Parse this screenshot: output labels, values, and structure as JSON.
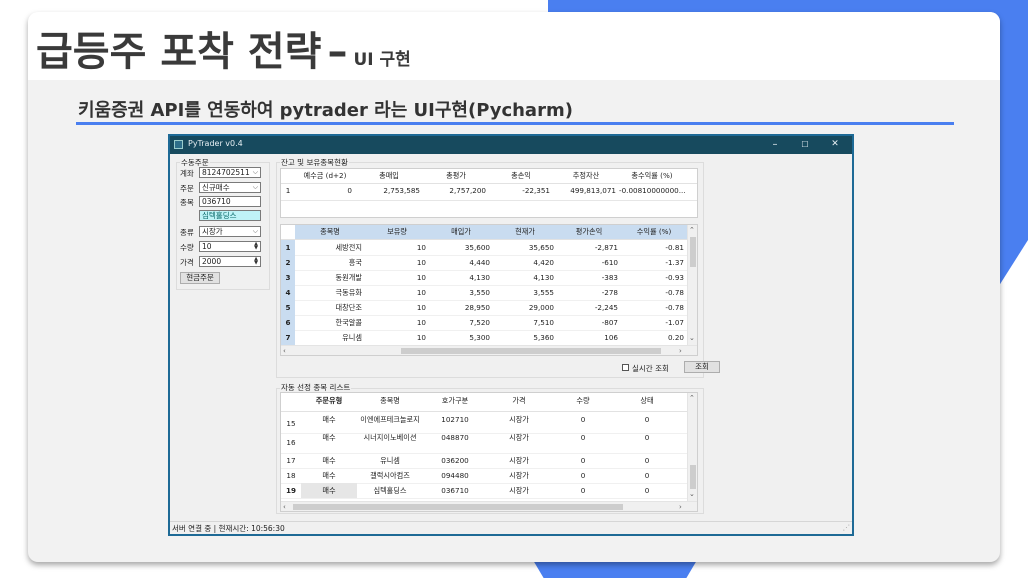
{
  "slide": {
    "title": "급등주 포착 전략",
    "title_dash": "–",
    "title_sub": "UI 구현",
    "subtitle": "키움증권 API를 연동하여 pytrader 라는 UI구현(Pycharm)",
    "accent_color": "#4a7ff0"
  },
  "window": {
    "title": "PyTrader v0.4",
    "buttons": {
      "minimize": "–",
      "maximize": "☐",
      "close": "✕"
    }
  },
  "order_panel": {
    "group_label": "수동주문",
    "account_label": "계좌",
    "account_value": "8124702511",
    "order_label": "주문",
    "order_value": "신규매수",
    "code_label": "종목",
    "code_value": "036710",
    "name_value": "심텍홀딩스",
    "type_label": "종류",
    "type_value": "시장가",
    "qty_label": "수량",
    "qty_value": "10",
    "price_label": "가격",
    "price_value": "2000",
    "submit_label": "현금주문"
  },
  "balance": {
    "group_label": "잔고 및 보유종목현황",
    "summary_headers": [
      "예수금 (d+2)",
      "총매입",
      "총평가",
      "총손익",
      "추정자산",
      "총수익률 (%)"
    ],
    "summary_row": {
      "index": "1",
      "cells": [
        "0",
        "2,753,585",
        "2,757,200",
        "-22,351",
        "499,813,071",
        "-0.00810000000..."
      ]
    },
    "holdings_headers": [
      "종목명",
      "보유량",
      "매입가",
      "현재가",
      "평가손익",
      "수익률 (%)"
    ],
    "holdings": [
      {
        "index": "1",
        "cells": [
          "세방전지",
          "10",
          "35,600",
          "35,650",
          "-2,871",
          "-0.81"
        ]
      },
      {
        "index": "2",
        "cells": [
          "흥국",
          "10",
          "4,440",
          "4,420",
          "-610",
          "-1.37"
        ]
      },
      {
        "index": "3",
        "cells": [
          "동원개발",
          "10",
          "4,130",
          "4,130",
          "-383",
          "-0.93"
        ]
      },
      {
        "index": "4",
        "cells": [
          "극동유화",
          "10",
          "3,550",
          "3,555",
          "-278",
          "-0.78"
        ]
      },
      {
        "index": "5",
        "cells": [
          "대창단조",
          "10",
          "28,950",
          "29,000",
          "-2,245",
          "-0.78"
        ]
      },
      {
        "index": "6",
        "cells": [
          "한국알콜",
          "10",
          "7,520",
          "7,510",
          "-807",
          "-1.07"
        ]
      },
      {
        "index": "7",
        "cells": [
          "유니셈",
          "10",
          "5,300",
          "5,360",
          "106",
          "0.20"
        ]
      }
    ],
    "realtime_label": "실시간 조회",
    "query_button": "조회"
  },
  "auto_list": {
    "group_label": "자동 선정 종목 리스트",
    "headers": [
      "주문유형",
      "종목명",
      "호가구분",
      "가격",
      "수량",
      "상태"
    ],
    "rows": [
      {
        "index": "15",
        "cells": [
          "매수",
          "이엔에프테크놀로지",
          "102710",
          "시장가",
          "0",
          "0"
        ]
      },
      {
        "index": "16",
        "cells": [
          "매수",
          "시너지이노베이션",
          "048870",
          "시장가",
          "0",
          "0"
        ]
      },
      {
        "index": "17",
        "cells": [
          "매수",
          "유니셈",
          "036200",
          "시장가",
          "0",
          "0"
        ]
      },
      {
        "index": "18",
        "cells": [
          "매수",
          "갤럭시아컴즈",
          "094480",
          "시장가",
          "0",
          "0"
        ]
      },
      {
        "index": "19",
        "cells": [
          "매수",
          "심텍홀딩스",
          "036710",
          "시장가",
          "0",
          "0"
        ]
      }
    ]
  },
  "statusbar": {
    "text": "서버 연결 중 | 현재시간: 10:56:30"
  }
}
